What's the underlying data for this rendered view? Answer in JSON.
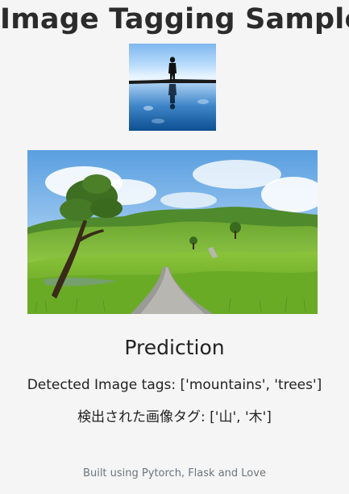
{
  "header": {
    "title": "Image Tagging Sample"
  },
  "thumbnail": {
    "alt": "Silhouette of a person standing on a reflective lakeshore"
  },
  "main_image": {
    "alt": "Green hills landscape with a tree and a gravel path"
  },
  "prediction": {
    "heading": "Prediction",
    "tags_en_line": "Detected Image tags: ['mountains', 'trees']",
    "tags_ja_line": "検出された画像タグ: ['山', '木']"
  },
  "footer": {
    "text": "Built using Pytorch, Flask and Love"
  }
}
